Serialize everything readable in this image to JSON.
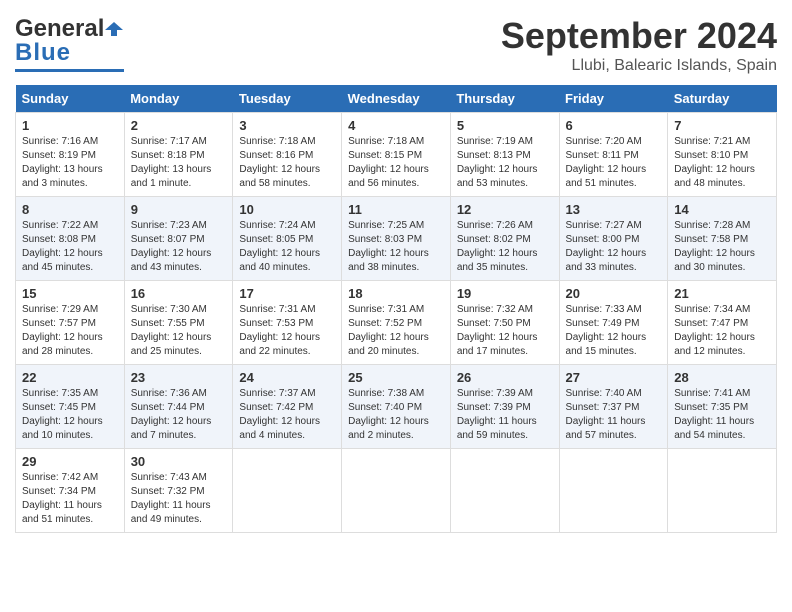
{
  "header": {
    "logo_general": "General",
    "logo_blue": "Blue",
    "month_title": "September 2024",
    "location": "Llubi, Balearic Islands, Spain"
  },
  "days_of_week": [
    "Sunday",
    "Monday",
    "Tuesday",
    "Wednesday",
    "Thursday",
    "Friday",
    "Saturday"
  ],
  "weeks": [
    [
      {
        "num": "1",
        "info": "Sunrise: 7:16 AM\nSunset: 8:19 PM\nDaylight: 13 hours\nand 3 minutes."
      },
      {
        "num": "2",
        "info": "Sunrise: 7:17 AM\nSunset: 8:18 PM\nDaylight: 13 hours\nand 1 minute."
      },
      {
        "num": "3",
        "info": "Sunrise: 7:18 AM\nSunset: 8:16 PM\nDaylight: 12 hours\nand 58 minutes."
      },
      {
        "num": "4",
        "info": "Sunrise: 7:18 AM\nSunset: 8:15 PM\nDaylight: 12 hours\nand 56 minutes."
      },
      {
        "num": "5",
        "info": "Sunrise: 7:19 AM\nSunset: 8:13 PM\nDaylight: 12 hours\nand 53 minutes."
      },
      {
        "num": "6",
        "info": "Sunrise: 7:20 AM\nSunset: 8:11 PM\nDaylight: 12 hours\nand 51 minutes."
      },
      {
        "num": "7",
        "info": "Sunrise: 7:21 AM\nSunset: 8:10 PM\nDaylight: 12 hours\nand 48 minutes."
      }
    ],
    [
      {
        "num": "8",
        "info": "Sunrise: 7:22 AM\nSunset: 8:08 PM\nDaylight: 12 hours\nand 45 minutes."
      },
      {
        "num": "9",
        "info": "Sunrise: 7:23 AM\nSunset: 8:07 PM\nDaylight: 12 hours\nand 43 minutes."
      },
      {
        "num": "10",
        "info": "Sunrise: 7:24 AM\nSunset: 8:05 PM\nDaylight: 12 hours\nand 40 minutes."
      },
      {
        "num": "11",
        "info": "Sunrise: 7:25 AM\nSunset: 8:03 PM\nDaylight: 12 hours\nand 38 minutes."
      },
      {
        "num": "12",
        "info": "Sunrise: 7:26 AM\nSunset: 8:02 PM\nDaylight: 12 hours\nand 35 minutes."
      },
      {
        "num": "13",
        "info": "Sunrise: 7:27 AM\nSunset: 8:00 PM\nDaylight: 12 hours\nand 33 minutes."
      },
      {
        "num": "14",
        "info": "Sunrise: 7:28 AM\nSunset: 7:58 PM\nDaylight: 12 hours\nand 30 minutes."
      }
    ],
    [
      {
        "num": "15",
        "info": "Sunrise: 7:29 AM\nSunset: 7:57 PM\nDaylight: 12 hours\nand 28 minutes."
      },
      {
        "num": "16",
        "info": "Sunrise: 7:30 AM\nSunset: 7:55 PM\nDaylight: 12 hours\nand 25 minutes."
      },
      {
        "num": "17",
        "info": "Sunrise: 7:31 AM\nSunset: 7:53 PM\nDaylight: 12 hours\nand 22 minutes."
      },
      {
        "num": "18",
        "info": "Sunrise: 7:31 AM\nSunset: 7:52 PM\nDaylight: 12 hours\nand 20 minutes."
      },
      {
        "num": "19",
        "info": "Sunrise: 7:32 AM\nSunset: 7:50 PM\nDaylight: 12 hours\nand 17 minutes."
      },
      {
        "num": "20",
        "info": "Sunrise: 7:33 AM\nSunset: 7:49 PM\nDaylight: 12 hours\nand 15 minutes."
      },
      {
        "num": "21",
        "info": "Sunrise: 7:34 AM\nSunset: 7:47 PM\nDaylight: 12 hours\nand 12 minutes."
      }
    ],
    [
      {
        "num": "22",
        "info": "Sunrise: 7:35 AM\nSunset: 7:45 PM\nDaylight: 12 hours\nand 10 minutes."
      },
      {
        "num": "23",
        "info": "Sunrise: 7:36 AM\nSunset: 7:44 PM\nDaylight: 12 hours\nand 7 minutes."
      },
      {
        "num": "24",
        "info": "Sunrise: 7:37 AM\nSunset: 7:42 PM\nDaylight: 12 hours\nand 4 minutes."
      },
      {
        "num": "25",
        "info": "Sunrise: 7:38 AM\nSunset: 7:40 PM\nDaylight: 12 hours\nand 2 minutes."
      },
      {
        "num": "26",
        "info": "Sunrise: 7:39 AM\nSunset: 7:39 PM\nDaylight: 11 hours\nand 59 minutes."
      },
      {
        "num": "27",
        "info": "Sunrise: 7:40 AM\nSunset: 7:37 PM\nDaylight: 11 hours\nand 57 minutes."
      },
      {
        "num": "28",
        "info": "Sunrise: 7:41 AM\nSunset: 7:35 PM\nDaylight: 11 hours\nand 54 minutes."
      }
    ],
    [
      {
        "num": "29",
        "info": "Sunrise: 7:42 AM\nSunset: 7:34 PM\nDaylight: 11 hours\nand 51 minutes."
      },
      {
        "num": "30",
        "info": "Sunrise: 7:43 AM\nSunset: 7:32 PM\nDaylight: 11 hours\nand 49 minutes."
      },
      {
        "num": "",
        "info": ""
      },
      {
        "num": "",
        "info": ""
      },
      {
        "num": "",
        "info": ""
      },
      {
        "num": "",
        "info": ""
      },
      {
        "num": "",
        "info": ""
      }
    ]
  ]
}
